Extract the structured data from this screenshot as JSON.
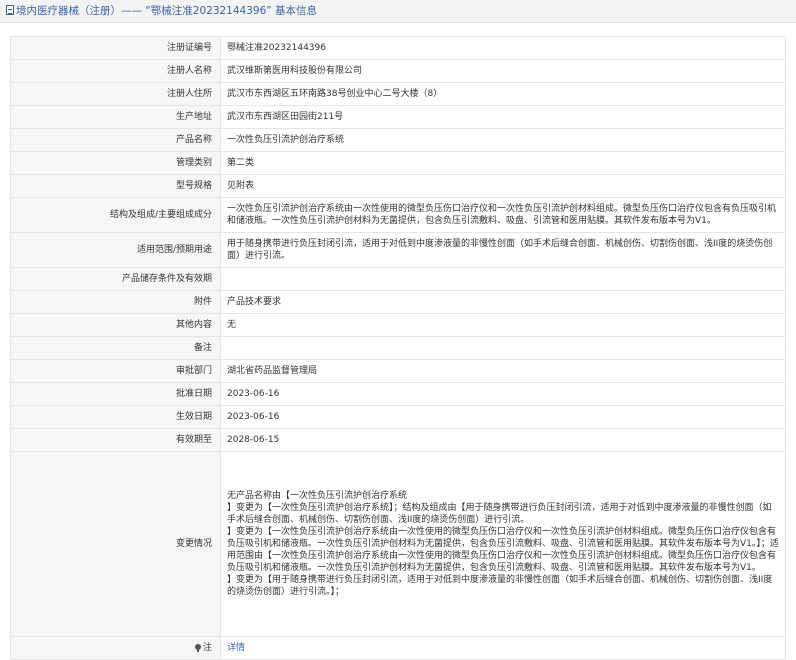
{
  "header": {
    "title": "境内医疗器械（注册）—— “鄂械注准20232144396” 基本信息"
  },
  "rows": [
    {
      "label": "注册证编号",
      "value": "鄂械注准20232144396"
    },
    {
      "label": "注册人名称",
      "value": "武汉维斯第医用科技股份有限公司"
    },
    {
      "label": "注册人住所",
      "value": "武汉市东西湖区五环南路38号创业中心二号大楼（8）"
    },
    {
      "label": "生产地址",
      "value": "武汉市东西湖区田园街211号"
    },
    {
      "label": "产品名称",
      "value": "一次性负压引流护创治疗系统"
    },
    {
      "label": "管理类别",
      "value": "第二类"
    },
    {
      "label": "型号规格",
      "value": "见附表"
    },
    {
      "label": "结构及组成/主要组成成分",
      "value": "一次性负压引流护创治疗系统由一次性使用的微型负压伤口治疗仪和一次性负压引流护创材料组成。微型负压伤口治疗仪包含有负压吸引机和储液瓶。一次性负压引流护创材料为无菌提供，包含负压引流敷料、吸盘、引流管和医用贴膜。其软件发布版本号为V1。"
    },
    {
      "label": "适用范围/预期用途",
      "value": "用于随身携带进行负压封闭引流，适用于对低到中度渗液量的非慢性创面（如手术后缝合创面、机械创伤、切割伤创面、浅II度的烧烫伤创面）进行引流。"
    },
    {
      "label": "产品储存条件及有效期",
      "value": ""
    },
    {
      "label": "附件",
      "value": "产品技术要求"
    },
    {
      "label": "其他内容",
      "value": "无"
    },
    {
      "label": "备注",
      "value": ""
    },
    {
      "label": "审批部门",
      "value": "湖北省药品监督管理局"
    },
    {
      "label": "批准日期",
      "value": "2023-06-16"
    },
    {
      "label": "生效日期",
      "value": "2023-06-16"
    },
    {
      "label": "有效期至",
      "value": "2028-06-15"
    }
  ],
  "change": {
    "label": "变更情况",
    "lines": [
      "无产品名称由【一次性负压引流护创治疗系统",
      "】变更为【一次性负压引流护创治疗系统】；结构及组成由【用于随身携带进行负压封闭引流，适用于对低到中度渗液量的非慢性创面（如手术后缝合创面、机械创伤、切割伤创面、浅II度的烧烫伤创面）进行引流。",
      "】变更为【一次性负压引流护创治疗系统由一次性使用的微型负压伤口治疗仪和一次性负压引流护创材料组成。微型负压伤口治疗仪包含有负压吸引机和储液瓶。一次性负压引流护创材料为无菌提供，包含负压引流敷料、吸盘、引流管和医用贴膜。其软件发布版本号为V1。】；适用范围由【一次性负压引流护创治疗系统由一次性使用的微型负压伤口治疗仪和一次性负压引流护创材料组成。微型负压伤口治疗仪包含有负压吸引机和储液瓶。一次性负压引流护创材料为无菌提供，包含负压引流敷料、吸盘、引流管和医用贴膜。其软件发布版本号为V1。",
      "】变更为【用于随身携带进行负压封闭引流，适用于对低到中度渗液量的非慢性创面（如手术后缝合创面、机械创伤、切割伤创面、浅II度的烧烫伤创面）进行引流。】；"
    ]
  },
  "note": {
    "label": "注",
    "link": "详情"
  }
}
